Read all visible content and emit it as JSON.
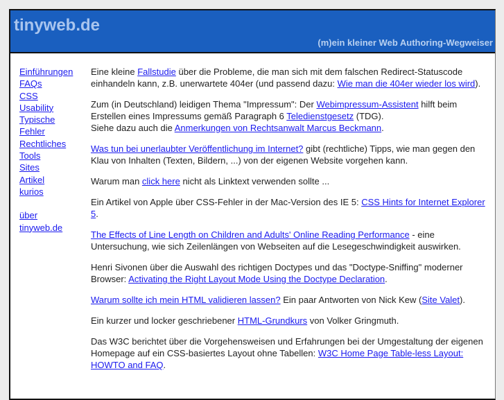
{
  "header": {
    "title": "tinyweb.de",
    "subtitle": "(m)ein kleiner Web Authoring-Wegweiser"
  },
  "nav": {
    "items": [
      "Einführungen",
      "FAQs",
      "CSS",
      "Usability",
      "Typische",
      "Fehler",
      "Rechtliches",
      "Tools",
      "Sites",
      "Artikel",
      "kurios"
    ],
    "about": [
      "über",
      "tinyweb.de"
    ]
  },
  "paragraphs": [
    [
      {
        "t": "Eine kleine "
      },
      {
        "t": "Fallstudie",
        "link": true
      },
      {
        "t": " über die Probleme, die man sich mit dem falschen Redirect-Statuscode einhandeln kann, z.B. unerwartete 404er (und passend dazu: "
      },
      {
        "t": "Wie man die 404er wieder los wird",
        "link": true
      },
      {
        "t": ")."
      }
    ],
    [
      {
        "t": "Zum (in Deutschland) leidigen Thema \"Impressum\": Der "
      },
      {
        "t": "Webimpressum-Assistent",
        "link": true
      },
      {
        "t": " hilft beim Erstellen eines Impressums gemäß Paragraph 6 "
      },
      {
        "t": "Teledienstgesetz",
        "link": true
      },
      {
        "t": " (TDG)."
      },
      {
        "br": true
      },
      {
        "t": "Siehe dazu auch die "
      },
      {
        "t": "Anmerkungen von Rechtsanwalt Marcus Beckmann",
        "link": true
      },
      {
        "t": "."
      }
    ],
    [
      {
        "t": "Was tun bei unerlaubter Veröffentlichung im Internet?",
        "link": true
      },
      {
        "t": " gibt (rechtliche) Tipps, wie man gegen den Klau von Inhalten (Texten, Bildern, ...) von der eigenen Website vorgehen kann."
      }
    ],
    [
      {
        "t": "Warum man "
      },
      {
        "t": "click here",
        "link": true
      },
      {
        "t": " nicht als Linktext verwenden sollte ..."
      }
    ],
    [
      {
        "t": "Ein Artikel von Apple über CSS-Fehler in der Mac-Version des IE 5: "
      },
      {
        "t": "CSS Hints for Internet Explorer 5",
        "link": true
      },
      {
        "t": "."
      }
    ],
    [
      {
        "t": "The Effects of Line Length on Children and Adults' Online Reading Performance",
        "link": true
      },
      {
        "t": " - eine Untersuchung, wie sich Zeilenlängen von Webseiten auf die Lesegeschwindigkeit auswirken."
      }
    ],
    [
      {
        "t": "Henri Sivonen über die Auswahl des richtigen Doctypes und das \"Doctype-Sniffing\" moderner Browser: "
      },
      {
        "t": "Activating the Right Layout Mode Using the Doctype Declaration",
        "link": true
      },
      {
        "t": "."
      }
    ],
    [
      {
        "t": "Warum sollte ich mein HTML validieren lassen?",
        "link": true
      },
      {
        "t": " Ein paar Antworten von Nick Kew ("
      },
      {
        "t": "Site Valet",
        "link": true
      },
      {
        "t": ")."
      }
    ],
    [
      {
        "t": "Ein kurzer und locker geschriebener "
      },
      {
        "t": "HTML-Grundkurs",
        "link": true
      },
      {
        "t": " von Volker Gringmuth."
      }
    ],
    [
      {
        "t": "Das W3C berichtet über die Vorgehensweisen und Erfahrungen bei der Umgestaltung der eigenen Homepage auf ein CSS-basiertes Layout ohne Tabellen: "
      },
      {
        "t": "W3C Home Page Table-less Layout: HOWTO and FAQ",
        "link": true
      },
      {
        "t": "."
      }
    ]
  ]
}
